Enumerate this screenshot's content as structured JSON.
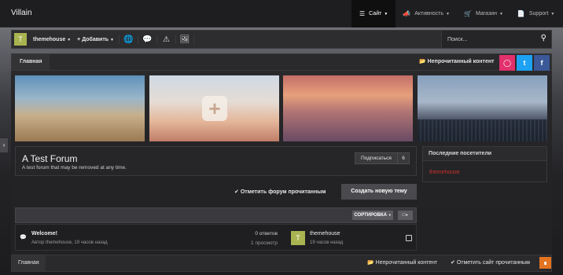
{
  "header": {
    "logo": "Villain",
    "nav": [
      {
        "label": "Сайт",
        "icon": "list-icon",
        "active": true
      },
      {
        "label": "Активность",
        "icon": "megaphone-icon"
      },
      {
        "label": "Магазин",
        "icon": "cart-icon"
      },
      {
        "label": "Support",
        "icon": "file-icon"
      }
    ]
  },
  "toolbar": {
    "avatar_letter": "T",
    "username": "themehouse",
    "add_label": "Добавить",
    "search_placeholder": "Поиск..."
  },
  "breadcrumb": {
    "home": "Главная",
    "unread": "Непрочитанный контент"
  },
  "social": {
    "instagram_color": "#e1306c",
    "twitter_color": "#1da1f2",
    "facebook_color": "#3b5998"
  },
  "forum": {
    "title": "A Test Forum",
    "description": "A test forum that may be removed at any time.",
    "subscribe_label": "Подписаться",
    "subscribe_count": "6",
    "mark_read": "Отметить форум прочитанным",
    "new_thread": "Создать новую тему"
  },
  "sidebar": {
    "title": "Последние посетители",
    "user": "themehouse",
    "user_color": "#d0312d"
  },
  "list": {
    "sort_label": "СОРТИРОВКА",
    "threads": [
      {
        "title": "Welcome!",
        "meta": "Автор themehouse, 19 часов назад",
        "replies": "0 ответов",
        "views": "1 просмотр",
        "last_avatar": "T",
        "last_user": "themehouse",
        "last_time": "19 часов назад"
      }
    ]
  },
  "footer": {
    "home": "Главная",
    "unread": "Непрочитанный контент",
    "mark_all": "Отметить сайт прочитанным"
  }
}
